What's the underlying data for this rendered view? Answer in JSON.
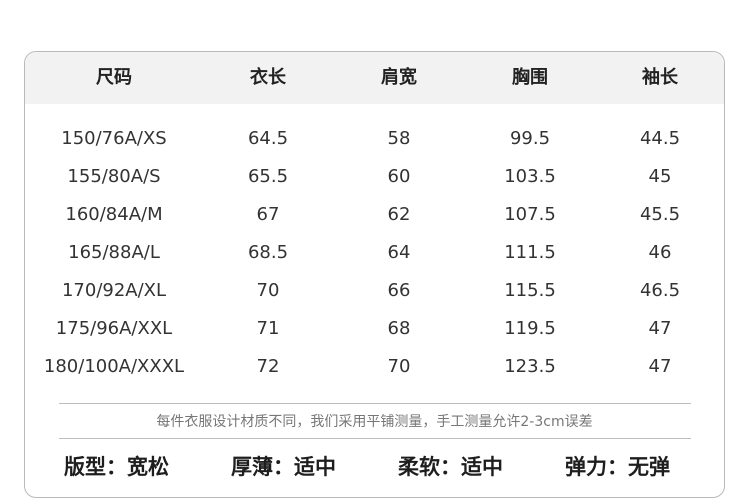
{
  "table": {
    "headers": [
      "尺码",
      "衣长",
      "肩宽",
      "胸围",
      "袖长"
    ],
    "rows": [
      [
        "150/76A/XS",
        "64.5",
        "58",
        "99.5",
        "44.5"
      ],
      [
        "155/80A/S",
        "65.5",
        "60",
        "103.5",
        "45"
      ],
      [
        "160/84A/M",
        "67",
        "62",
        "107.5",
        "45.5"
      ],
      [
        "165/88A/L",
        "68.5",
        "64",
        "111.5",
        "46"
      ],
      [
        "170/92A/XL",
        "70",
        "66",
        "115.5",
        "46.5"
      ],
      [
        "175/96A/XXL",
        "71",
        "68",
        "119.5",
        "47"
      ],
      [
        "180/100A/XXXL",
        "72",
        "70",
        "123.5",
        "47"
      ]
    ]
  },
  "note": "每件衣服设计材质不同，我们采用平铺测量，手工测量允许2-3cm误差",
  "attributes": [
    "版型：宽松",
    "厚薄：适中",
    "柔软：适中",
    "弹力：无弹"
  ]
}
